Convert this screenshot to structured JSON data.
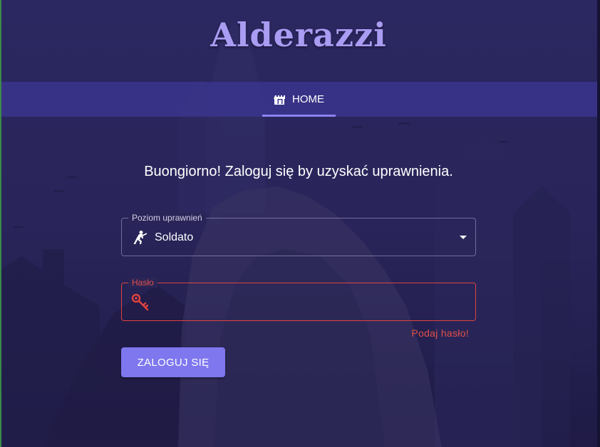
{
  "app": {
    "logo_text": "Alderazzi"
  },
  "nav": {
    "tabs": [
      {
        "label": "HOME",
        "icon": "castle-icon",
        "active": true
      }
    ]
  },
  "login": {
    "greeting": "Buongiorno! Zaloguj się by uzyskać uprawnienia.",
    "role_field": {
      "label": "Poziom uprawnień",
      "value": "Soldato",
      "icon": "soldier-icon"
    },
    "password_field": {
      "label": "Hasło",
      "value": "",
      "icon": "key-icon",
      "error": "Podaj hasło!"
    },
    "submit_label": "ZALOGUJ SIĘ"
  },
  "colors": {
    "background": "#242052",
    "accent": "#7e77ee",
    "logo": "#a99cf2",
    "error": "#e0423f",
    "navbar": "#3e3896"
  }
}
